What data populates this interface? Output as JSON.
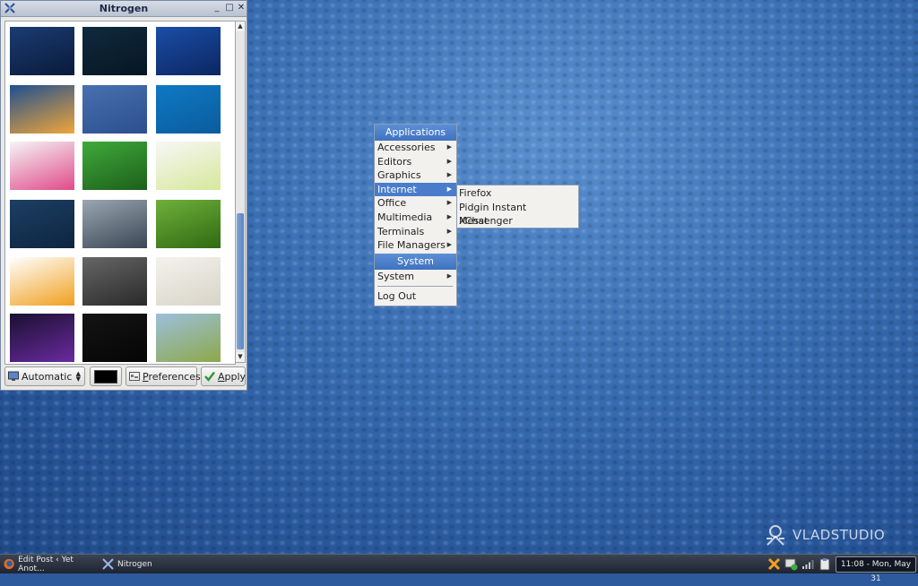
{
  "window": {
    "title": "Nitrogen",
    "controls": {
      "minimize": "_",
      "maximize": "□",
      "close": "✕"
    }
  },
  "thumbnails": [
    {
      "name": "abstract-dark-blue",
      "colors": [
        "#1b3c72",
        "#0a1a3a"
      ]
    },
    {
      "name": "dark-tunnel",
      "colors": [
        "#0f2a3e",
        "#061622"
      ]
    },
    {
      "name": "night-sky-stars",
      "colors": [
        "#1a4ea6",
        "#0c2662"
      ]
    },
    {
      "name": "sunset-planet",
      "colors": [
        "#1f4f8f",
        "#f0a63a"
      ]
    },
    {
      "name": "blue-curves",
      "colors": [
        "#4870b0",
        "#2c4f8e"
      ]
    },
    {
      "name": "blue-hanging-figure",
      "colors": [
        "#0f79c4",
        "#0a5c9c"
      ]
    },
    {
      "name": "rainbow-vader",
      "colors": [
        "#f5f5f5",
        "#e04a8a"
      ]
    },
    {
      "name": "green-characters",
      "colors": [
        "#3faa3a",
        "#1d5f1b"
      ]
    },
    {
      "name": "lemons-glass",
      "colors": [
        "#f7f7f7",
        "#d6e89a"
      ]
    },
    {
      "name": "dark-blue-snow",
      "colors": [
        "#1c3f63",
        "#0d2540"
      ]
    },
    {
      "name": "gray-clouds",
      "colors": [
        "#9aa6b2",
        "#3a4653"
      ]
    },
    {
      "name": "green-grass",
      "colors": [
        "#6fb03a",
        "#2f6a12"
      ]
    },
    {
      "name": "fruit-pacman",
      "colors": [
        "#ffffff",
        "#f0a020"
      ]
    },
    {
      "name": "gray-gears",
      "colors": [
        "#666666",
        "#2a2a2a"
      ]
    },
    {
      "name": "pencil-quote",
      "colors": [
        "#f4f2ec",
        "#d8d4c8"
      ]
    },
    {
      "name": "neon-lights",
      "colors": [
        "#1a1030",
        "#6a2aa0"
      ]
    },
    {
      "name": "black-pattern",
      "colors": [
        "#141414",
        "#050505"
      ]
    },
    {
      "name": "wheat-field",
      "colors": [
        "#9cc0dc",
        "#8da84a"
      ]
    }
  ],
  "controls": {
    "mode": "Automatic",
    "preferences_label": "Preferences",
    "preferences_underline": "P",
    "apply_label": "Apply",
    "apply_underline": "A",
    "bg_color": "#000000"
  },
  "app_menu": {
    "header": "Applications",
    "items": [
      {
        "label": "Accessories",
        "submenu": true
      },
      {
        "label": "Editors",
        "submenu": true
      },
      {
        "label": "Graphics",
        "submenu": true
      },
      {
        "label": "Internet",
        "submenu": true,
        "highlighted": true
      },
      {
        "label": "Office",
        "submenu": true
      },
      {
        "label": "Multimedia",
        "submenu": true
      },
      {
        "label": "Terminals",
        "submenu": true
      },
      {
        "label": "File Managers",
        "submenu": true
      }
    ],
    "system_header": "System",
    "system_items": [
      {
        "label": "System",
        "submenu": true
      }
    ],
    "logout_label": "Log Out"
  },
  "internet_submenu": {
    "items": [
      "Firefox",
      "Pidgin Instant Messenger",
      "XChat"
    ]
  },
  "watermark": "VLADSTUDIO",
  "taskbar": {
    "tasks": [
      {
        "label": "Edit Post ‹ Yet Anot...",
        "icon": "firefox-icon"
      },
      {
        "label": "Nitrogen",
        "icon": "nitrogen-icon"
      }
    ],
    "clock": "11:08 - Mon, May 31"
  }
}
